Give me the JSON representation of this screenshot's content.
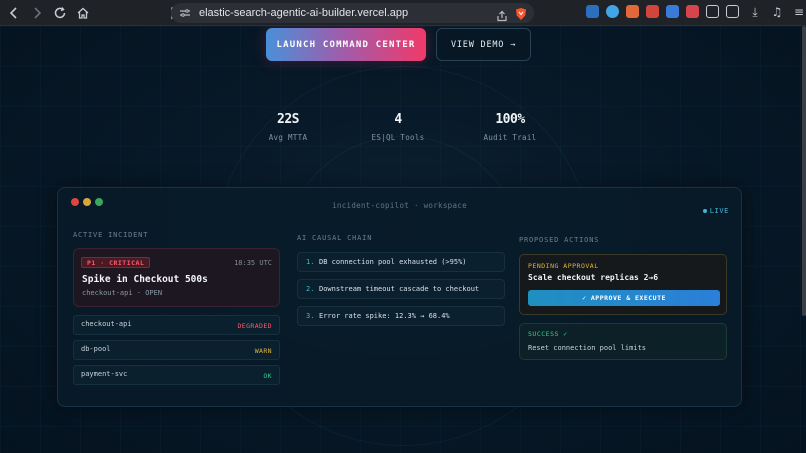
{
  "browser": {
    "url": "elastic-search-agentic-ai-builder.vercel.app"
  },
  "hero": {
    "primary_cta": "LAUNCH COMMAND CENTER",
    "secondary_cta": "VIEW DEMO →"
  },
  "stats": [
    {
      "value": "22S",
      "label": "Avg MTTA"
    },
    {
      "value": "4",
      "label": "ES|QL Tools"
    },
    {
      "value": "100%",
      "label": "Audit Trail"
    }
  ],
  "workspace": {
    "title": "incident-copilot · workspace",
    "live_label": "LIVE",
    "active_incident": {
      "section_label": "ACTIVE INCIDENT",
      "severity": "P1 · CRITICAL",
      "time": "18:35 UTC",
      "title": "Spike in Checkout 500s",
      "subtitle": "checkout-api · OPEN",
      "services": [
        {
          "name": "checkout-api",
          "status": "DEGRADED",
          "color": "#ff5a6e"
        },
        {
          "name": "db-pool",
          "status": "WARN",
          "color": "#e0b43c"
        },
        {
          "name": "payment-svc",
          "status": "OK",
          "color": "#39c98a"
        }
      ]
    },
    "causal_chain": {
      "section_label": "AI CAUSAL CHAIN",
      "steps": [
        {
          "num": "1.",
          "text": "DB connection pool exhausted (>95%)"
        },
        {
          "num": "2.",
          "text": "Downstream timeout cascade to checkout"
        },
        {
          "num": "3.",
          "text": "Error rate spike: 12.3% → 68.4%"
        }
      ]
    },
    "proposed_actions": {
      "section_label": "PROPOSED ACTIONS",
      "pending_label": "PENDING APPROVAL",
      "pending_title": "Scale checkout replicas 2→6",
      "approve_label": "✓ APPROVE & EXECUTE",
      "success_label": "SUCCESS ✓",
      "success_text": "Reset connection pool limits"
    }
  },
  "colors": {
    "accent": "#3fb7d6",
    "critical": "#ff5a6e",
    "warn": "#e0b43c",
    "ok": "#39c98a"
  }
}
